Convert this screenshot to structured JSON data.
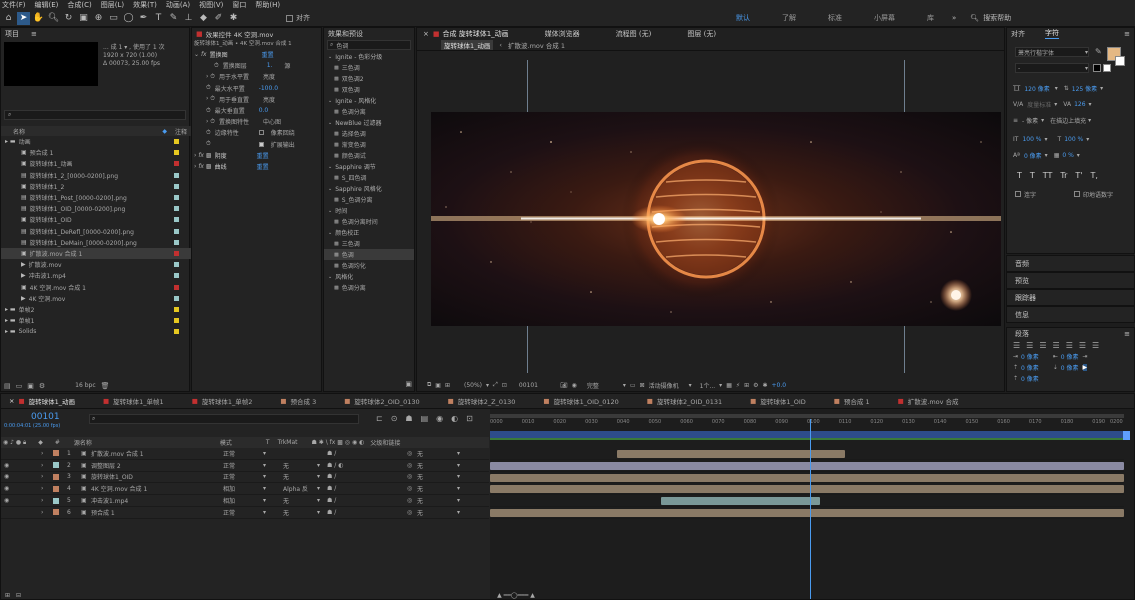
{
  "menu": [
    "文件(F)",
    "编辑(E)",
    "合成(C)",
    "图层(L)",
    "效果(T)",
    "动画(A)",
    "视图(V)",
    "窗口",
    "帮助(H)"
  ],
  "toolbar": {
    "snap_label": "对齐",
    "workspaces": [
      "默认",
      "了解",
      "标准",
      "小屏幕",
      "库"
    ],
    "search_placeholder": "搜索帮助"
  },
  "project": {
    "title": "项目",
    "comp_name": "... 成 1 ▾ , 使用了 1 次",
    "comp_res": "1920 x 720 (1.00)",
    "comp_dur": "Δ 00073, 25.00 fps",
    "col_name": "名称",
    "col_note": "注释",
    "items": [
      {
        "name": "动画",
        "color": "#e6c820",
        "kind": "folder"
      },
      {
        "name": "预合成 1",
        "color": "#e6c820",
        "kind": "comp"
      },
      {
        "name": "旋转球体1_动画",
        "color": "#c23030",
        "kind": "comp"
      },
      {
        "name": "旋转球体1_2_[0000-0200].png",
        "color": "#9ac8c8",
        "kind": "img"
      },
      {
        "name": "旋转球体1_2",
        "color": "#9ac8c8",
        "kind": "comp"
      },
      {
        "name": "旋转球体1_Post_[0000-0200].png",
        "color": "#9ac8c8",
        "kind": "img"
      },
      {
        "name": "旋转球体1_OID_[0000-0200].png",
        "color": "#9ac8c8",
        "kind": "img"
      },
      {
        "name": "旋转球体1_OID",
        "color": "#9ac8c8",
        "kind": "comp"
      },
      {
        "name": "旋转球体1_DeRefl_[0000-0200].png",
        "color": "#9ac8c8",
        "kind": "img"
      },
      {
        "name": "旋转球体1_DeMain_[0000-0200].png",
        "color": "#9ac8c8",
        "kind": "img"
      },
      {
        "name": "扩散波.mov 合成 1",
        "color": "#c23030",
        "kind": "comp"
      },
      {
        "name": "扩散波.mov",
        "color": "#9ac8c8",
        "kind": "vid"
      },
      {
        "name": "冲击波1.mp4",
        "color": "#9ac8c8",
        "kind": "vid"
      },
      {
        "name": "4K 空洞.mov 合成 1",
        "color": "#c23030",
        "kind": "comp"
      },
      {
        "name": "4K 空洞.mov",
        "color": "#9ac8c8",
        "kind": "vid"
      },
      {
        "name": "单帧2",
        "color": "#e6c820",
        "kind": "folder"
      },
      {
        "name": "单帧1",
        "color": "#e6c820",
        "kind": "folder"
      },
      {
        "name": "Solids",
        "color": "#e6c820",
        "kind": "folder"
      }
    ],
    "bpc": "16 bpc"
  },
  "effects_controls": {
    "title": "效果控件 4K 空洞.mov",
    "subtitle": "旋转球体1_动画 • 4K 空洞.mov 合成 1",
    "fx1_name": "置换图",
    "fx1_reset": "重置",
    "rows": [
      {
        "label": "置换图层",
        "value": "1.",
        "value2": "源"
      },
      {
        "label": "用于水平置",
        "value": "亮度",
        "value2": ""
      },
      {
        "label": "最大水平置",
        "value": "-100.0",
        "value2": ""
      },
      {
        "label": "用于垂直置",
        "value": "亮度",
        "value2": ""
      },
      {
        "label": "最大垂直置",
        "value": "0.0",
        "value2": ""
      },
      {
        "label": "置换图特性",
        "value": "中心图",
        "value2": ""
      },
      {
        "label": "边缘特性",
        "value": "像素回绕",
        "value2": ""
      },
      {
        "label": "",
        "value": "扩展输出",
        "value2": ""
      }
    ],
    "fx2_name": "阴度",
    "fx2_reset": "重置",
    "fx3_name": "曲线",
    "fx3_reset": "重置"
  },
  "effects_presets": {
    "title": "效果和预设",
    "search_value": "色调",
    "items": [
      {
        "label": "Ignite - 色彩分级",
        "cat": true
      },
      {
        "label": "三色调",
        "cat": false
      },
      {
        "label": "双色调2",
        "cat": false
      },
      {
        "label": "双色调",
        "cat": false
      },
      {
        "label": "Ignite - 风格化",
        "cat": true
      },
      {
        "label": "色调分离",
        "cat": false
      },
      {
        "label": "NewBlue 过滤器",
        "cat": true
      },
      {
        "label": "选择色调",
        "cat": false
      },
      {
        "label": "渐变色调",
        "cat": false
      },
      {
        "label": "颜色调试",
        "cat": false
      },
      {
        "label": "Sapphire 调节",
        "cat": true
      },
      {
        "label": "S_四色调",
        "cat": false
      },
      {
        "label": "Sapphire 风格化",
        "cat": true
      },
      {
        "label": "S_色调分离",
        "cat": false
      },
      {
        "label": "时间",
        "cat": true
      },
      {
        "label": "色调分离时间",
        "cat": false
      },
      {
        "label": "颜色校正",
        "cat": true
      },
      {
        "label": "三色调",
        "cat": false
      },
      {
        "label": "色调",
        "cat": false
      },
      {
        "label": "色调均化",
        "cat": false
      },
      {
        "label": "风格化",
        "cat": true
      },
      {
        "label": "色调分离",
        "cat": false
      }
    ]
  },
  "composition": {
    "tabs": [
      "合成 旋转球体1_动画",
      "媒体浏览器",
      "流程图 (无)",
      "图层 (无)"
    ],
    "sub_tabs": [
      "旋转球体1_动画",
      "扩散波.mov 合成 1"
    ],
    "zoom": "(50%)",
    "timecode": "00101",
    "quality": "完整",
    "camera": "活动摄像机",
    "views": "1个...",
    "offset": "+0.0"
  },
  "character": {
    "tabs": [
      "对齐",
      "字符"
    ],
    "font": "萧亮行楷字体",
    "style": "-",
    "size": "120 像素",
    "leading": "125 像素",
    "kerning": "度量标准",
    "tracking": "126",
    "stroke": "- 像素",
    "stroke_mode": "在描边上填充",
    "vscale": "100 %",
    "hscale": "100 %",
    "baseline": "0 像素",
    "tsume": "0 %",
    "styles": [
      "T",
      "T",
      "TT",
      "Tr",
      "T'",
      "T,"
    ],
    "ligature": "连字",
    "hindi": "印地语数字",
    "fill_color": "#e4b884"
  },
  "right_panels": [
    "音频",
    "预览",
    "跟踪器",
    "信息"
  ],
  "paragraph": {
    "title": "段落",
    "indent1": "0 像素",
    "indent2": "0 像素",
    "indent3": "0 像素",
    "space1": "0 像素",
    "space2": "0 像素"
  },
  "timeline": {
    "tabs": [
      {
        "name": "旋转球体1_动画",
        "color": "#c23030"
      },
      {
        "name": "旋转球体1_单帧1",
        "color": "#c23030"
      },
      {
        "name": "旋转球体1_单帧2",
        "color": "#c23030"
      },
      {
        "name": "预合成 3",
        "color": "#c08060"
      },
      {
        "name": "旋转球体2_OID_0130",
        "color": "#c08060"
      },
      {
        "name": "旋转球体2_Z_0130",
        "color": "#c08060"
      },
      {
        "name": "旋转球体1_OID_0120",
        "color": "#c08060"
      },
      {
        "name": "旋转球体2_OID_0131",
        "color": "#c08060"
      },
      {
        "name": "旋转球体1_OID",
        "color": "#c08060"
      },
      {
        "name": "预合成 1",
        "color": "#c08060"
      },
      {
        "name": "扩散波.mov 合成",
        "color": "#c23030"
      }
    ],
    "timecode": "00101",
    "timecode_sub": "0:00:04:01 (25.00 fps)",
    "col_num": "#",
    "col_source": "源名称",
    "col_mode": "模式",
    "col_t": "T",
    "col_trkmat": "TrkMat",
    "col_parent": "父级和链接",
    "ruler": [
      "0000",
      "0010",
      "0020",
      "0030",
      "0040",
      "0050",
      "0060",
      "0070",
      "0080",
      "0090",
      "0100",
      "0110",
      "0120",
      "0130",
      "0140",
      "0150",
      "0160",
      "0170",
      "0180",
      "0190",
      "0200"
    ],
    "layers": [
      {
        "num": "1",
        "name": "扩散波.mov 合成 1",
        "mode": "正常",
        "trk": "",
        "parent": "无",
        "color": "#c08060",
        "bar_start": 0.2,
        "bar_end": 0.56,
        "bar_color": "#8a7a66"
      },
      {
        "num": "2",
        "name": "调整图层 2",
        "mode": "正常",
        "trk": "无",
        "parent": "无",
        "color": "#9ac8c8",
        "bar_start": 0.0,
        "bar_end": 1.0,
        "bar_color": "#8a8aa2"
      },
      {
        "num": "3",
        "name": "旋转球体1_OID",
        "mode": "正常",
        "trk": "无",
        "parent": "无",
        "color": "#c08060",
        "bar_start": 0.0,
        "bar_end": 1.0,
        "bar_color": "#8a7a66"
      },
      {
        "num": "4",
        "name": "4K 空洞.mov 合成 1",
        "mode": "相加",
        "trk": "Alpha 反",
        "parent": "无",
        "color": "#c08060",
        "bar_start": 0.0,
        "bar_end": 1.0,
        "bar_color": "#8a7a66"
      },
      {
        "num": "5",
        "name": "冲击波1.mp4",
        "mode": "相加",
        "trk": "无",
        "parent": "无",
        "color": "#9ac8c8",
        "bar_start": 0.27,
        "bar_end": 0.52,
        "bar_color": "#7a9898"
      },
      {
        "num": "6",
        "name": "预合成 1",
        "mode": "正常",
        "trk": "无",
        "parent": "无",
        "color": "#c08060",
        "bar_start": 0.0,
        "bar_end": 1.0,
        "bar_color": "#8a7a66"
      }
    ],
    "playhead": 0.505
  }
}
